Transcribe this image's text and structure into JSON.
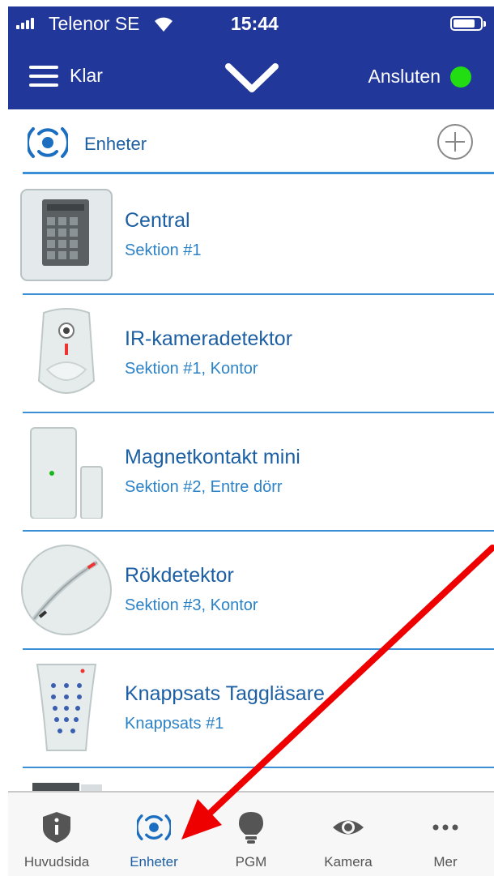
{
  "status_bar": {
    "carrier": "Telenor SE",
    "time": "15:44",
    "icons": [
      "signal-icon",
      "wifi-icon",
      "battery-icon"
    ]
  },
  "nav": {
    "menu_label": "Klar",
    "connection_label": "Ansluten",
    "connection_color": "#22dd11",
    "icons": [
      "hamburger-icon",
      "chevron-down-icon",
      "status-dot-icon"
    ]
  },
  "section": {
    "title": "Enheter",
    "icons": [
      "devices-icon",
      "add-icon"
    ]
  },
  "devices": [
    {
      "name": "Central",
      "subtitle": "Sektion #1",
      "icon": "control-panel-icon"
    },
    {
      "name": "IR-kameradetektor",
      "subtitle": "Sektion #1, Kontor",
      "icon": "ir-camera-detector-icon"
    },
    {
      "name": "Magnetkontakt mini",
      "subtitle": "Sektion #2, Entre dörr",
      "icon": "magnet-contact-icon"
    },
    {
      "name": "Rökdetektor",
      "subtitle": "Sektion #3, Kontor",
      "icon": "smoke-detector-icon"
    },
    {
      "name": "Knappsats Taggläsare",
      "subtitle": "Knappsats #1",
      "icon": "keypad-icon"
    }
  ],
  "tabs": [
    {
      "label": "Huvudsida",
      "icon": "shield-icon",
      "active": false
    },
    {
      "label": "Enheter",
      "icon": "devices-icon",
      "active": true
    },
    {
      "label": "PGM",
      "icon": "lightbulb-icon",
      "active": false
    },
    {
      "label": "Kamera",
      "icon": "eye-icon",
      "active": false
    },
    {
      "label": "Mer",
      "icon": "more-icon",
      "active": false
    }
  ],
  "colors": {
    "header_bg": "#22379a",
    "accent": "#1c5fa3",
    "divider": "#3a8fd6",
    "annotation_arrow": "#ee0000"
  }
}
